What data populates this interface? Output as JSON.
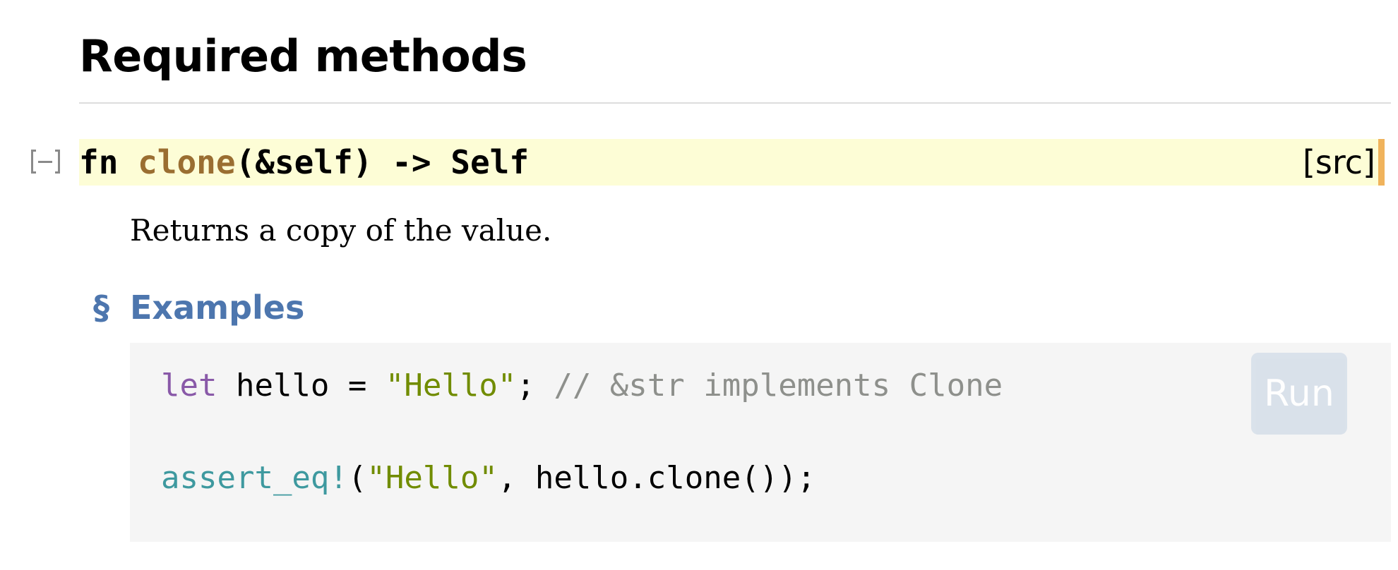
{
  "section": {
    "title": "Required methods"
  },
  "method": {
    "toggle_label": "[−]",
    "keyword": "fn",
    "name": "clone",
    "params": "(&self)",
    "arrow": "->",
    "return_type": "Self",
    "src_label": "[src]"
  },
  "docs": {
    "summary": "Returns a copy of the value.",
    "examples_anchor": "§",
    "examples_heading": "Examples"
  },
  "code": {
    "line1": {
      "keyword": "let",
      "ident_assign": " hello = ",
      "string": "\"Hello\"",
      "semi": "; ",
      "comment": "// &str implements Clone"
    },
    "line2": {
      "macro": "assert_eq!",
      "open": "(",
      "string": "\"Hello\"",
      "rest": ", hello.clone());"
    },
    "run_label": "Run"
  },
  "colors": {
    "heading_text": "#000000",
    "rule": "#dddddd",
    "method_highlight_bg": "#fdfdd6",
    "method_accent": "#f0b35c",
    "fn_name": "#9a6e31",
    "link_blue": "#4d76ae",
    "code_bg": "#f5f5f5",
    "keyword": "#8959a8",
    "string": "#718c00",
    "comment": "#8e908c",
    "macro": "#3e999f",
    "run_button_bg": "#d8e0ea"
  }
}
